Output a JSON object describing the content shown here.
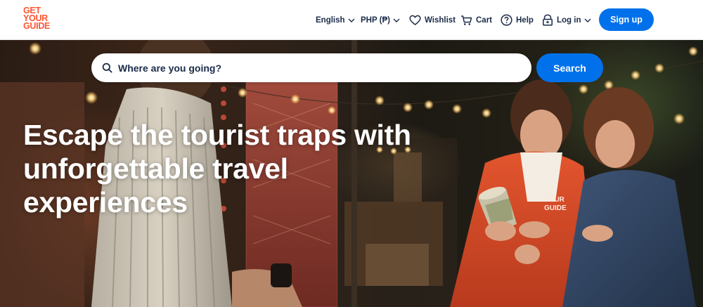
{
  "header": {
    "logo": [
      "GET",
      "YOUR",
      "GUIDE"
    ],
    "language": "English",
    "currency": "PHP (₱)",
    "wishlist": "Wishlist",
    "cart": "Cart",
    "help": "Help",
    "login": "Log in",
    "signup": "Sign up"
  },
  "hero": {
    "search_placeholder": "Where are you going?",
    "search_button": "Search",
    "headline": "Escape the tourist traps with unforgettable travel experiences",
    "badge_text": "YOUR GUIDE"
  },
  "colors": {
    "brand": "#ff5533",
    "primary_button": "#0071eb",
    "nav_text": "#1a2b49"
  }
}
